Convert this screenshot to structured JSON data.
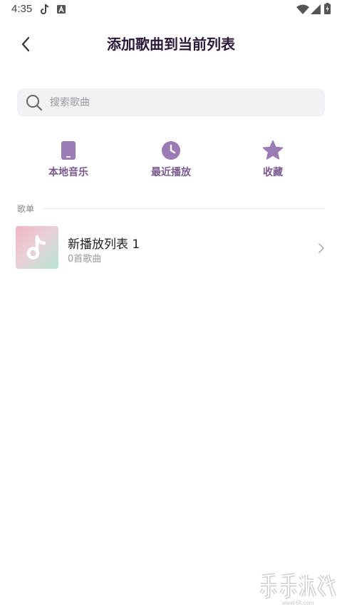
{
  "status_bar": {
    "time": "4:35"
  },
  "header": {
    "title": "添加歌曲到当前列表"
  },
  "search": {
    "placeholder": "搜索歌曲"
  },
  "quick_actions": [
    {
      "label": "本地音乐",
      "icon": "phone-icon"
    },
    {
      "label": "最近播放",
      "icon": "clock-icon"
    },
    {
      "label": "收藏",
      "icon": "star-icon"
    }
  ],
  "section": {
    "label": "歌单"
  },
  "playlists": [
    {
      "name": "新播放列表 1",
      "count": "0首歌曲"
    }
  ],
  "watermark": {
    "text": "乐乐游戏"
  },
  "colors": {
    "accent": "#9b7bb5",
    "title": "#2a1a38",
    "search_bg": "#f2f2f4"
  }
}
